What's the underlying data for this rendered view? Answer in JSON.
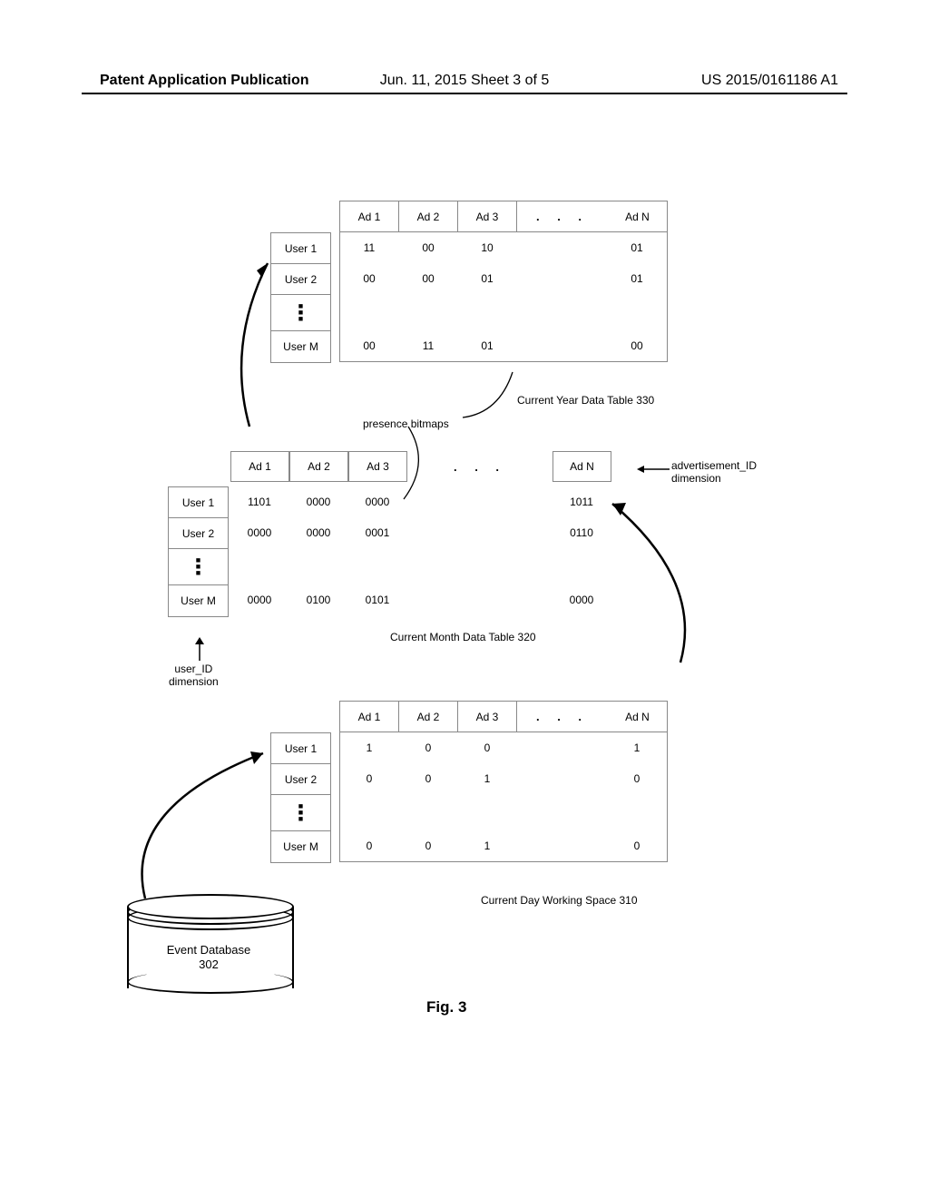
{
  "header": {
    "left": "Patent Application Publication",
    "center": "Jun. 11, 2015  Sheet 3 of 5",
    "right": "US 2015/0161186 A1"
  },
  "ads": {
    "a1": "Ad 1",
    "a2": "Ad 2",
    "a3": "Ad 3",
    "an": "Ad N"
  },
  "users": {
    "u1": "User 1",
    "u2": "User 2",
    "um": "User M"
  },
  "dots": ". . .",
  "vdots": "■\n■\n■",
  "year": {
    "label": "Current Year Data Table 330",
    "r1": {
      "a1": "11",
      "a2": "00",
      "a3": "10",
      "an": "01"
    },
    "r2": {
      "a1": "00",
      "a2": "00",
      "a3": "01",
      "an": "01"
    },
    "rm": {
      "a1": "00",
      "a2": "11",
      "a3": "01",
      "an": "00"
    }
  },
  "month": {
    "label": "Current Month Data Table 320",
    "r1": {
      "a1": "1101",
      "a2": "0000",
      "a3": "0000",
      "an": "1011"
    },
    "r2": {
      "a1": "0000",
      "a2": "0000",
      "a3": "0001",
      "an": "0110"
    },
    "rm": {
      "a1": "0000",
      "a2": "0100",
      "a3": "0101",
      "an": "0000"
    }
  },
  "day": {
    "label": "Current Day Working Space 310",
    "r1": {
      "a1": "1",
      "a2": "0",
      "a3": "0",
      "an": "1"
    },
    "r2": {
      "a1": "0",
      "a2": "0",
      "a3": "1",
      "an": "0"
    },
    "rm": {
      "a1": "0",
      "a2": "0",
      "a3": "1",
      "an": "0"
    }
  },
  "labels": {
    "presence": "presence bitmaps",
    "adDim": "advertisement_ID\ndimension",
    "userDim": "user_ID\ndimension",
    "db": "Event Database\n302",
    "fig": "Fig. 3"
  },
  "chart_data": {
    "type": "table",
    "tables": [
      {
        "name": "Current Year Data Table 330",
        "row_dim": "user_ID",
        "col_dim": "advertisement_ID",
        "rows": [
          "User 1",
          "User 2",
          "User M"
        ],
        "cols": [
          "Ad 1",
          "Ad 2",
          "Ad 3",
          "Ad N"
        ],
        "values": [
          [
            "11",
            "00",
            "10",
            "01"
          ],
          [
            "00",
            "00",
            "01",
            "01"
          ],
          [
            "00",
            "11",
            "01",
            "00"
          ]
        ]
      },
      {
        "name": "Current Month Data Table 320",
        "row_dim": "user_ID",
        "col_dim": "advertisement_ID",
        "rows": [
          "User 1",
          "User 2",
          "User M"
        ],
        "cols": [
          "Ad 1",
          "Ad 2",
          "Ad 3",
          "Ad N"
        ],
        "values": [
          [
            "1101",
            "0000",
            "0000",
            "1011"
          ],
          [
            "0000",
            "0000",
            "0001",
            "0110"
          ],
          [
            "0000",
            "0100",
            "0101",
            "0000"
          ]
        ]
      },
      {
        "name": "Current Day Working Space 310",
        "row_dim": "user_ID",
        "col_dim": "advertisement_ID",
        "rows": [
          "User 1",
          "User 2",
          "User M"
        ],
        "cols": [
          "Ad 1",
          "Ad 2",
          "Ad 3",
          "Ad N"
        ],
        "values": [
          [
            "1",
            "0",
            "0",
            "1"
          ],
          [
            "0",
            "0",
            "1",
            "0"
          ],
          [
            "0",
            "0",
            "1",
            "0"
          ]
        ]
      }
    ],
    "annotations": [
      "presence bitmaps",
      "advertisement_ID dimension",
      "user_ID dimension"
    ],
    "source": "Event Database 302"
  }
}
